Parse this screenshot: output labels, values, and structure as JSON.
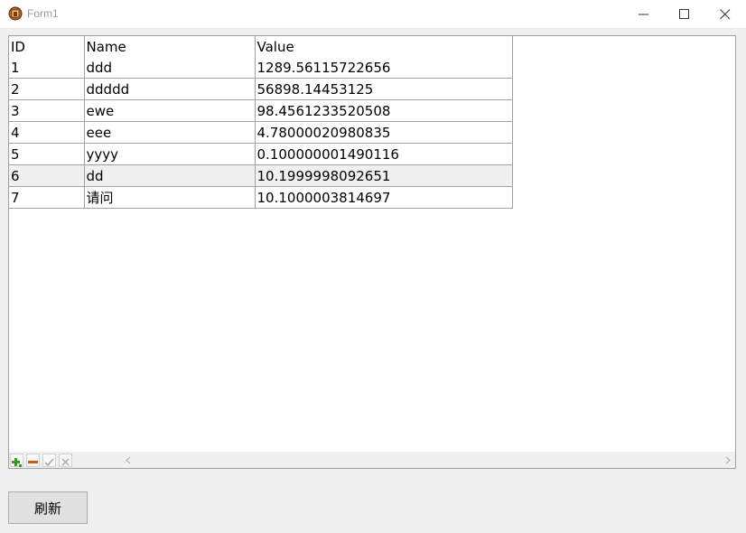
{
  "window": {
    "title": "Form1",
    "icon": "delphi-app-icon",
    "controls": [
      "minimize-icon",
      "maximize-icon",
      "close-icon"
    ]
  },
  "grid": {
    "columns": [
      "ID",
      "Name",
      "Value"
    ],
    "rows": [
      {
        "id": "1",
        "name": "ddd",
        "value": "1289.56115722656"
      },
      {
        "id": "2",
        "name": "ddddd",
        "value": "56898.14453125"
      },
      {
        "id": "3",
        "name": "ewe",
        "value": "98.4561233520508"
      },
      {
        "id": "4",
        "name": "eee",
        "value": "4.78000020980835"
      },
      {
        "id": "5",
        "name": "yyyy",
        "value": "0.100000001490116"
      },
      {
        "id": "6",
        "name": "dd",
        "value": "10.1999998092651"
      },
      {
        "id": "7",
        "name": "请问",
        "value": "10.1000003814697"
      }
    ],
    "selected_row": 6,
    "navigator": [
      "insert-icon",
      "delete-icon",
      "post-icon",
      "cancel-icon"
    ]
  },
  "buttons": {
    "refresh_label": "刷新"
  },
  "colors": {
    "grid_line": "#a0a0a0",
    "selected_row_bg": "#f0f0f0",
    "insert_green": "#3a9a1a",
    "delete_orange": "#d9560e"
  }
}
